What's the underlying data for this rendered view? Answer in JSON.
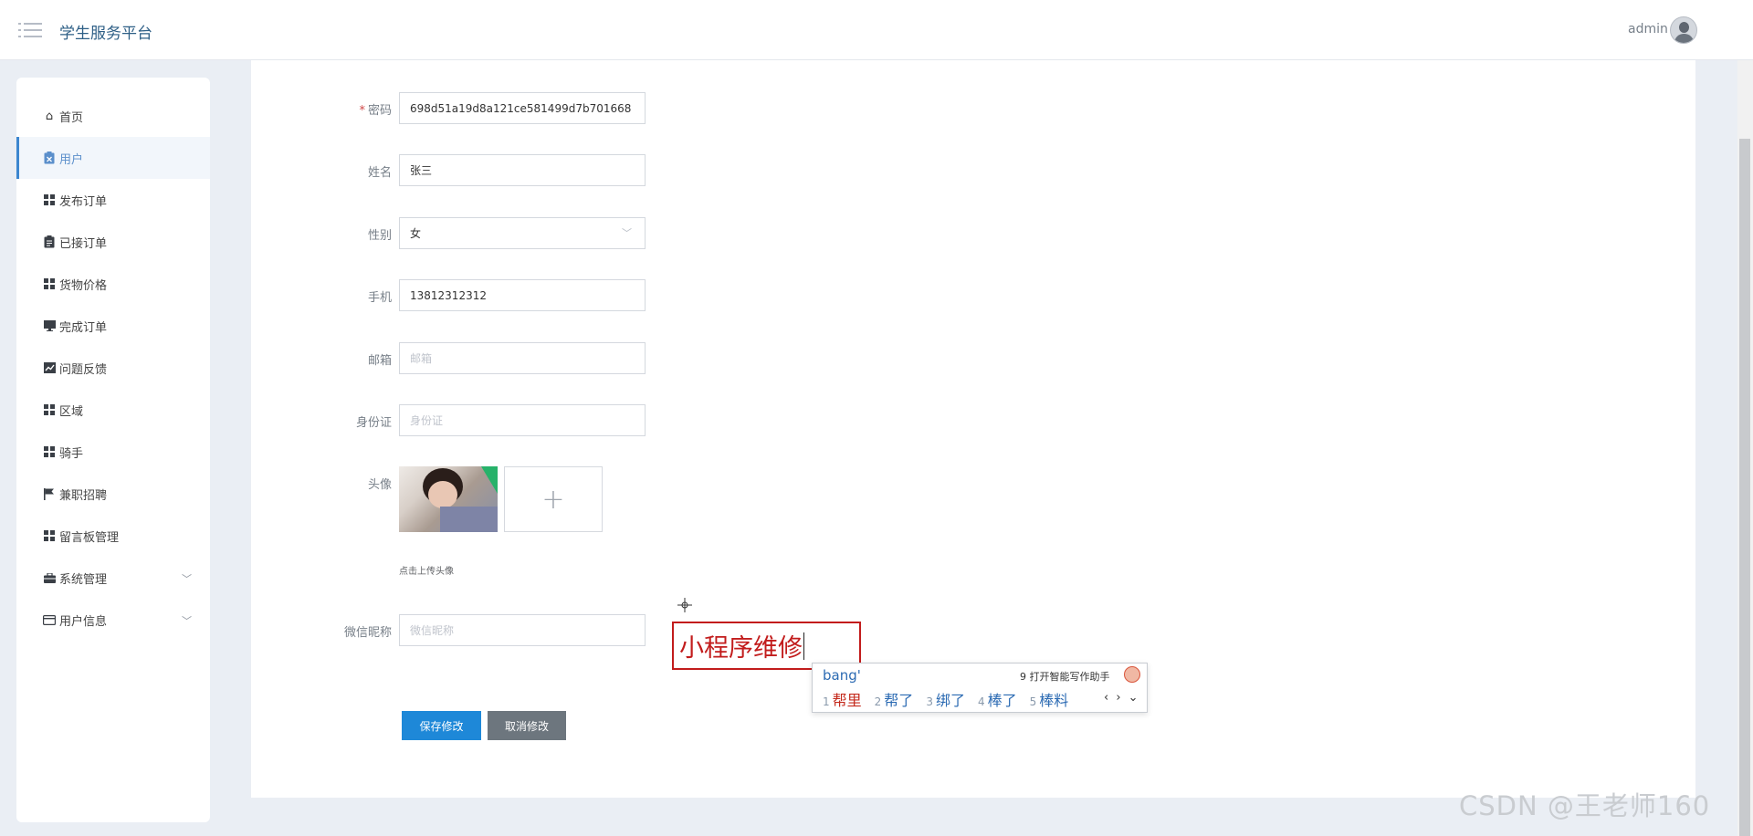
{
  "header": {
    "title": "学生服务平台",
    "user_name": "admin"
  },
  "sidebar": {
    "items": [
      {
        "label": "首页",
        "icon": "home-icon",
        "active": false
      },
      {
        "label": "用户",
        "icon": "clipboard-icon",
        "active": true
      },
      {
        "label": "发布订单",
        "icon": "grid-icon",
        "active": false
      },
      {
        "label": "已接订单",
        "icon": "clipboard-icon",
        "active": false
      },
      {
        "label": "货物价格",
        "icon": "grid-icon",
        "active": false
      },
      {
        "label": "完成订单",
        "icon": "monitor-icon",
        "active": false
      },
      {
        "label": "问题反馈",
        "icon": "chart-icon",
        "active": false
      },
      {
        "label": "区域",
        "icon": "grid-icon",
        "active": false
      },
      {
        "label": "骑手",
        "icon": "grid-icon",
        "active": false
      },
      {
        "label": "兼职招聘",
        "icon": "flag-icon",
        "active": false
      },
      {
        "label": "留言板管理",
        "icon": "grid-icon",
        "active": false
      },
      {
        "label": "系统管理",
        "icon": "briefcase-icon",
        "active": false,
        "expandable": true
      },
      {
        "label": "用户信息",
        "icon": "card-icon",
        "active": false,
        "expandable": true
      }
    ]
  },
  "form": {
    "password": {
      "label": "密码",
      "required_mark": "*",
      "value": "698d51a19d8a121ce581499d7b701668"
    },
    "name": {
      "label": "姓名",
      "value": "张三"
    },
    "gender": {
      "label": "性别",
      "value": "女"
    },
    "phone": {
      "label": "手机",
      "value": "13812312312"
    },
    "email": {
      "label": "邮箱",
      "placeholder": "邮箱"
    },
    "id_card": {
      "label": "身份证",
      "placeholder": "身份证"
    },
    "avatar": {
      "label": "头像",
      "upload_hint": "点击上传头像",
      "add_symbol": "+"
    },
    "wechat": {
      "label": "微信昵称",
      "placeholder": "微信昵称"
    },
    "save_label": "保存修改",
    "cancel_label": "取消修改"
  },
  "overlay": {
    "edit_text": "小程序维修",
    "ime": {
      "pinyin": "bang'",
      "assist": "9 打开智能写作助手",
      "candidates": [
        {
          "num": "1",
          "text": "帮里"
        },
        {
          "num": "2",
          "text": "帮了"
        },
        {
          "num": "3",
          "text": "绑了"
        },
        {
          "num": "4",
          "text": "棒了"
        },
        {
          "num": "5",
          "text": "棒料"
        }
      ],
      "nav": "‹ › ⌄"
    }
  },
  "watermark": "CSDN @王老师160"
}
